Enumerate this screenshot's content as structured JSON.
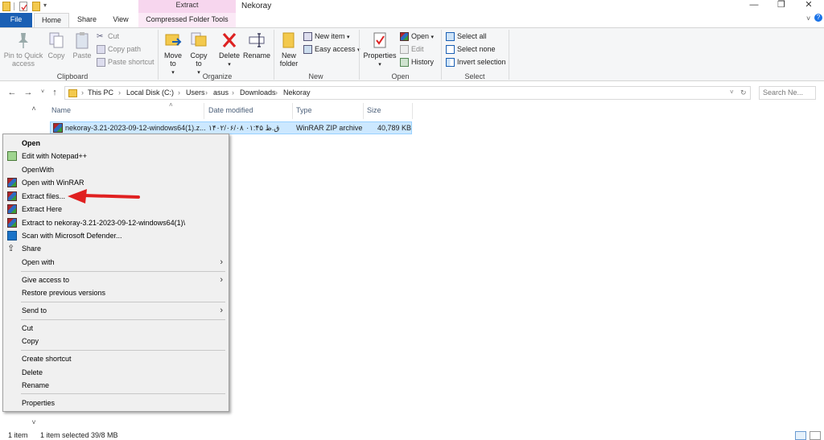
{
  "window": {
    "title": "Nekoray",
    "controls": {
      "minimize": "—",
      "restore": "❐",
      "close": "✕"
    }
  },
  "tabs": {
    "file": "File",
    "home": "Home",
    "share": "Share",
    "view": "View",
    "contextual_header": "Extract",
    "contextual_tab": "Compressed Folder Tools"
  },
  "ribbon": {
    "clipboard": {
      "label": "Clipboard",
      "pin": "Pin to Quick access",
      "copy": "Copy",
      "paste": "Paste",
      "cut": "Cut",
      "copy_path": "Copy path",
      "paste_shortcut": "Paste shortcut"
    },
    "organize": {
      "label": "Organize",
      "move_to": "Move to",
      "copy_to": "Copy to",
      "delete": "Delete",
      "rename": "Rename"
    },
    "new": {
      "label": "New",
      "new_folder": "New folder",
      "new_item": "New item",
      "easy_access": "Easy access"
    },
    "open": {
      "label": "Open",
      "properties": "Properties",
      "open": "Open",
      "edit": "Edit",
      "history": "History"
    },
    "select": {
      "label": "Select",
      "select_all": "Select all",
      "select_none": "Select none",
      "invert": "Invert selection"
    }
  },
  "address": {
    "crumbs": [
      "This PC",
      "Local Disk (C:)",
      "Users",
      "asus",
      "Downloads",
      "Nekoray"
    ],
    "search_placeholder": "Search Ne..."
  },
  "columns": {
    "name": "Name",
    "date": "Date modified",
    "type": "Type",
    "size": "Size"
  },
  "file": {
    "name": "nekoray-3.21-2023-09-12-windows64(1).z...",
    "date": "۱۴۰۲/۰۶/۰۸ ق.ظ ۰۱:۴۵",
    "type": "WinRAR ZIP archive",
    "size": "40,789 KB"
  },
  "context_menu": {
    "open": "Open",
    "edit_notepad": "Edit with Notepad++",
    "open_with_plain": "OpenWith",
    "open_winrar": "Open with WinRAR",
    "extract_files": "Extract files...",
    "extract_here": "Extract Here",
    "extract_to": "Extract to nekoray-3.21-2023-09-12-windows64(1)\\",
    "scan": "Scan with Microsoft Defender...",
    "share": "Share",
    "open_with": "Open with",
    "give_access": "Give access to",
    "restore": "Restore previous versions",
    "send_to": "Send to",
    "cut": "Cut",
    "copy": "Copy",
    "create_shortcut": "Create shortcut",
    "delete": "Delete",
    "rename": "Rename",
    "properties": "Properties"
  },
  "status": {
    "items": "1 item",
    "selected": "1 item selected  39/8 MB"
  },
  "colors": {
    "accent": "#1a5fb4",
    "selection": "#cce8ff",
    "arrow": "#e02020"
  }
}
